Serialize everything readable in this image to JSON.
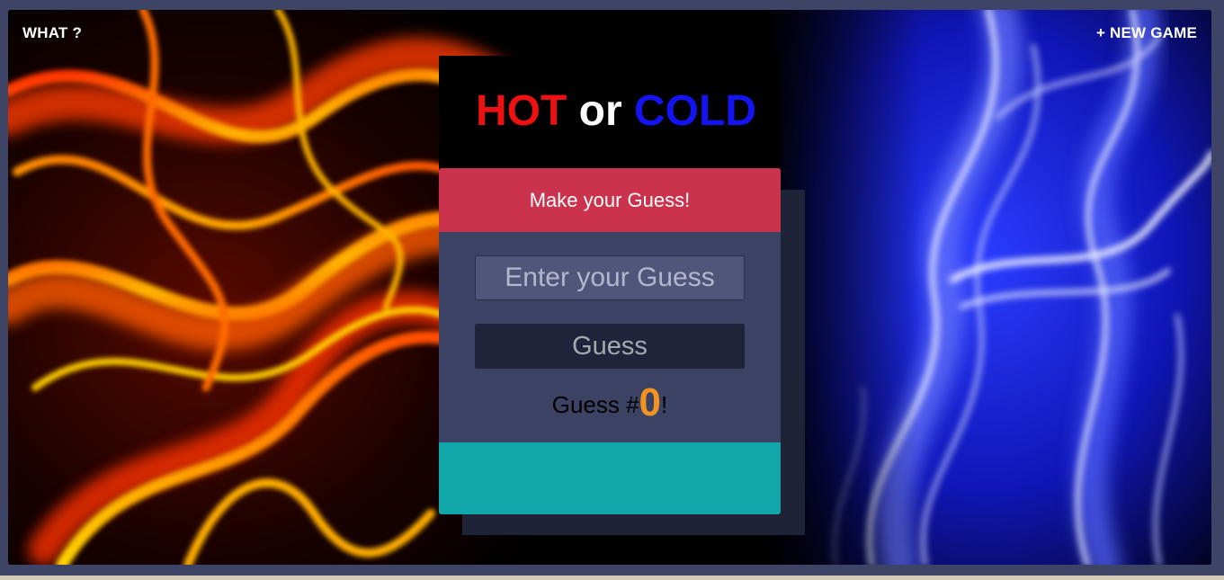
{
  "nav": {
    "what_label": "WHAT ?",
    "new_game_label": "+ NEW GAME"
  },
  "title": {
    "hot": "HOT",
    "or": "or",
    "cold": "COLD",
    "colors": {
      "hot": "#ee1111",
      "or": "#ffffff",
      "cold": "#1414f0"
    }
  },
  "card": {
    "header": "Make your Guess!",
    "input_placeholder": "Enter your Guess",
    "input_value": "",
    "button_label": "Guess",
    "count_prefix": "Guess #",
    "count_value": "0",
    "count_suffix": "!",
    "feedback_text": ""
  },
  "colors": {
    "header_bg": "#cb334c",
    "card_bg": "#3b4263",
    "feedback_bg": "#11a6aa",
    "count_accent": "#f39420"
  }
}
